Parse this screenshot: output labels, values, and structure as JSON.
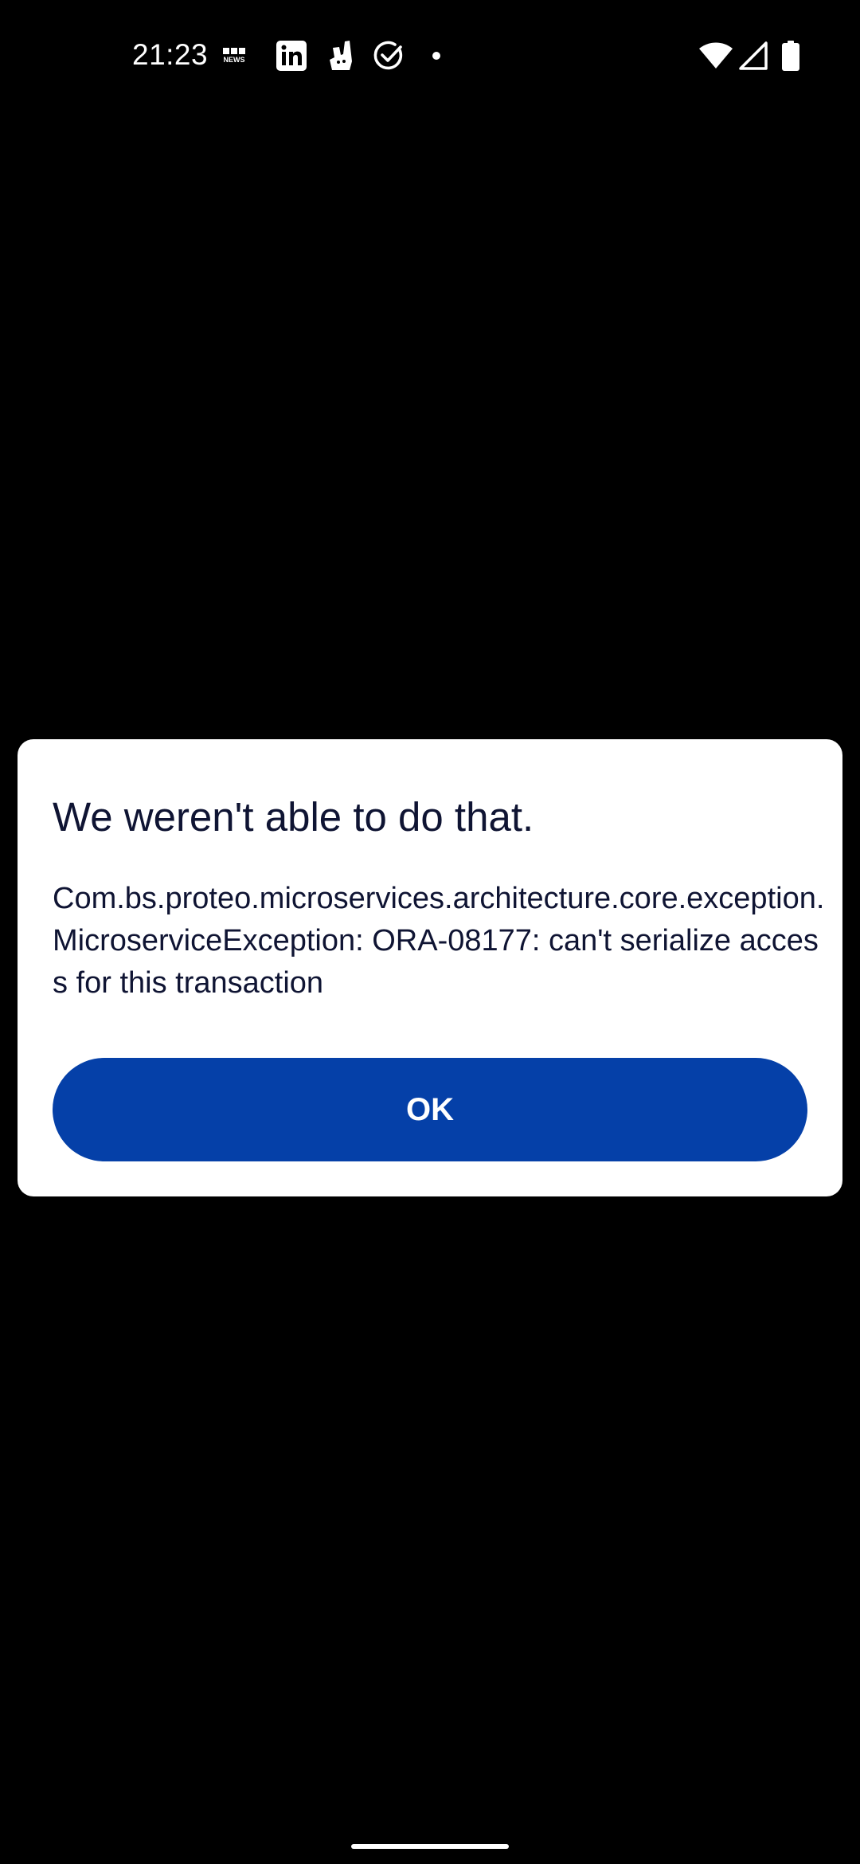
{
  "status_bar": {
    "time": "21:23",
    "notification_icons": [
      "bbc-news-icon",
      "linkedin-icon",
      "deliveroo-icon",
      "check-circle-icon",
      "dot-icon"
    ],
    "bbc_news_text": "NEWS",
    "system_icons": [
      "wifi-icon",
      "signal-icon",
      "battery-icon"
    ]
  },
  "dialog": {
    "title": "We weren't able to do that.",
    "message": "Com.bs.proteo.microservices.architecture.core.exception.MicroserviceException: ORA-08177: can't serialize access for this transaction",
    "ok_label": "OK"
  },
  "colors": {
    "background": "#000000",
    "dialog_background": "#ffffff",
    "text": "#0f1433",
    "button": "#0540a8",
    "button_text": "#ffffff"
  }
}
